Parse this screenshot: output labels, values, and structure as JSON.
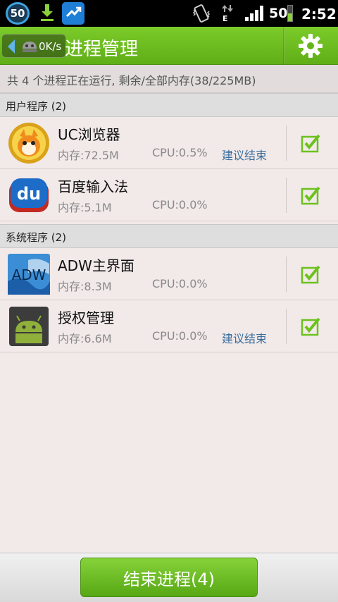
{
  "status_bar": {
    "badge": "50",
    "network": "E",
    "battery_text": "50",
    "battery_level": 0.5,
    "time": "2:52",
    "icons": [
      "download-icon",
      "app-icon",
      "vibrate-icon",
      "data-arrows-icon",
      "signal-icon",
      "battery-icon"
    ]
  },
  "title_bar": {
    "speed": "0K/s",
    "title": "进程管理",
    "settings_icon": "gear-icon"
  },
  "summary": "共 4 个进程正在运行, 剩余/全部内存(38/225MB)",
  "sections": {
    "user": "用户程序 (2)",
    "system": "系统程序 (2)"
  },
  "user_apps": [
    {
      "name": "UC浏览器",
      "mem": "内存:72.5M",
      "cpu": "CPU:0.5%",
      "end": "建议结束",
      "checked": true
    },
    {
      "name": "百度输入法",
      "mem": "内存:5.1M",
      "cpu": "CPU:0.0%",
      "end": "",
      "checked": true
    }
  ],
  "system_apps": [
    {
      "name": "ADW主界面",
      "mem": "内存:8.3M",
      "cpu": "CPU:0.0%",
      "end": "",
      "checked": true
    },
    {
      "name": "授权管理",
      "mem": "内存:6.6M",
      "cpu": "CPU:0.0%",
      "end": "建议结束",
      "checked": true
    }
  ],
  "end_button": "结束进程(4)",
  "colors": {
    "accent_green": "#6bbd1f",
    "link_blue": "#3a6e9c",
    "check_green": "#6cc21c"
  }
}
